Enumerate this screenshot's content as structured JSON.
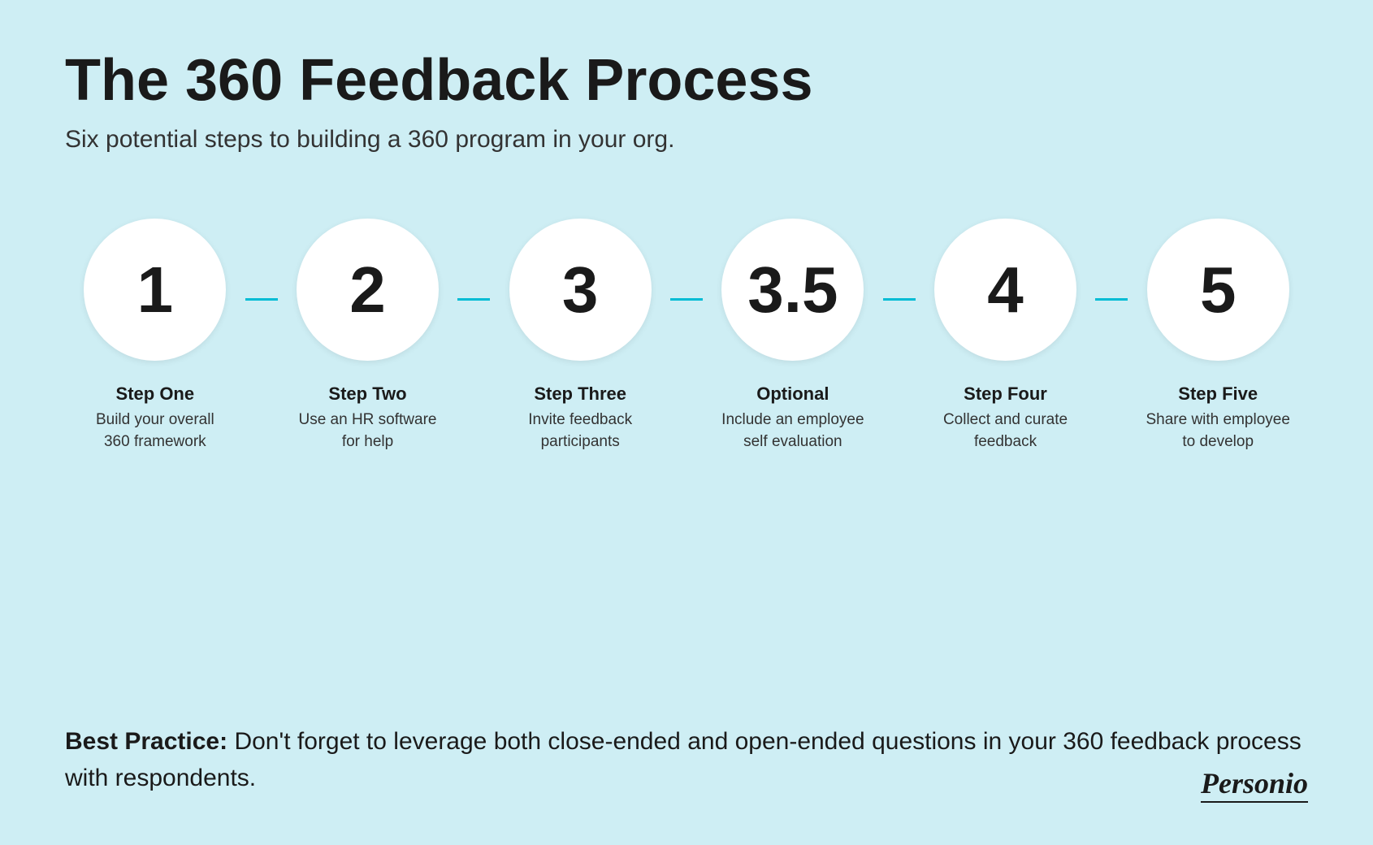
{
  "header": {
    "title": "The 360 Feedback Process",
    "subtitle": "Six potential steps to building a 360 program in your org."
  },
  "steps": [
    {
      "number": "1",
      "title": "Step One",
      "description": "Build your overall 360 framework"
    },
    {
      "number": "2",
      "title": "Step Two",
      "description": "Use an HR software for help"
    },
    {
      "number": "3",
      "title": "Step Three",
      "description": "Invite feedback participants"
    },
    {
      "number": "3.5",
      "title": "Optional",
      "description": "Include an employee self evaluation"
    },
    {
      "number": "4",
      "title": "Step Four",
      "description": "Collect and curate feedback"
    },
    {
      "number": "5",
      "title": "Step Five",
      "description": "Share with employee to develop"
    }
  ],
  "best_practice": {
    "bold_text": "Best Practice:",
    "regular_text": " Don't forget to leverage both close-ended and open-ended questions in your 360 feedback process with respondents."
  },
  "logo": {
    "text": "Personio"
  }
}
